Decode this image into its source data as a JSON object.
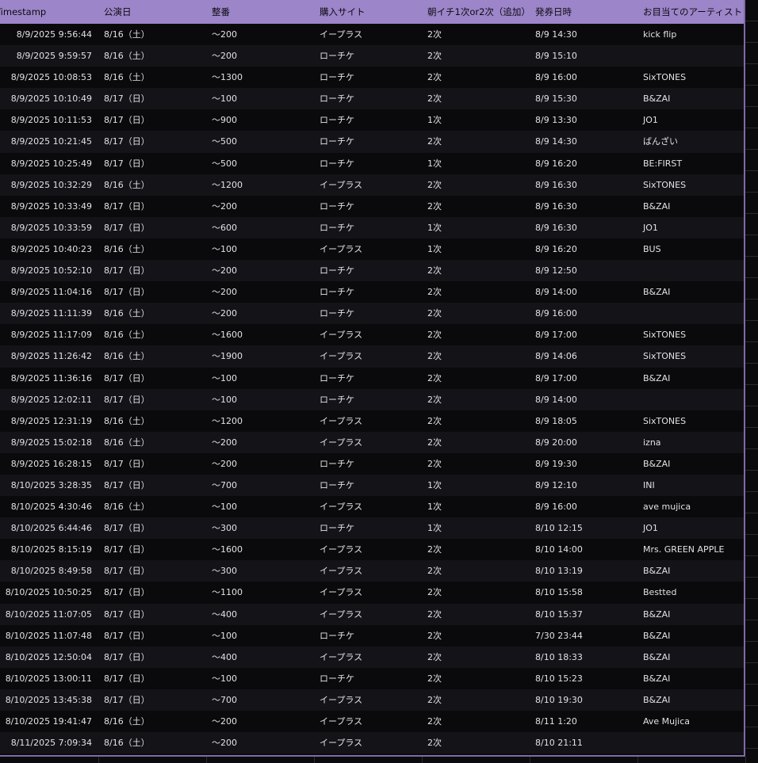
{
  "columns": {
    "timestamp": "Timestamp",
    "performance_date": "公演日",
    "ticket_number": "整番",
    "purchase_site": "購入サイト",
    "round": "朝イチ1次or2次（追加）",
    "release_datetime": "発券日時",
    "target_artist": "お目当てのアーティスト"
  },
  "rows": [
    [
      "8/9/2025 9:56:44",
      "8/16（土）",
      "〜200",
      "イープラス",
      "2次",
      "8/9 14:30",
      "kick flip"
    ],
    [
      "8/9/2025 9:59:57",
      "8/16（土）",
      "〜200",
      "ローチケ",
      "2次",
      "8/9 15:10",
      ""
    ],
    [
      "8/9/2025 10:08:53",
      "8/16（土）",
      "〜1300",
      "ローチケ",
      "2次",
      "8/9 16:00",
      "SixTONES"
    ],
    [
      "8/9/2025 10:10:49",
      "8/17（日）",
      "〜100",
      "ローチケ",
      "2次",
      "8/9 15:30",
      "B&ZAI"
    ],
    [
      "8/9/2025 10:11:53",
      "8/17（日）",
      "〜900",
      "ローチケ",
      "1次",
      "8/9 13:30",
      "JO1"
    ],
    [
      "8/9/2025 10:21:45",
      "8/17（日）",
      "〜500",
      "ローチケ",
      "2次",
      "8/9 14:30",
      "ばんざい"
    ],
    [
      "8/9/2025 10:25:49",
      "8/17（日）",
      "〜500",
      "ローチケ",
      "1次",
      "8/9 16:20",
      "BE:FIRST"
    ],
    [
      "8/9/2025 10:32:29",
      "8/16（土）",
      "〜1200",
      "イープラス",
      "2次",
      "8/9 16:30",
      "SixTONES"
    ],
    [
      "8/9/2025 10:33:49",
      "8/17（日）",
      "〜200",
      "ローチケ",
      "2次",
      "8/9 16:30",
      "B&ZAI"
    ],
    [
      "8/9/2025 10:33:59",
      "8/17（日）",
      "〜600",
      "ローチケ",
      "1次",
      "8/9 16:30",
      "JO1"
    ],
    [
      "8/9/2025 10:40:23",
      "8/16（土）",
      "〜100",
      "イープラス",
      "1次",
      "8/9 16:20",
      "BUS"
    ],
    [
      "8/9/2025 10:52:10",
      "8/17（日）",
      "〜200",
      "ローチケ",
      "2次",
      "8/9 12:50",
      ""
    ],
    [
      "8/9/2025 11:04:16",
      "8/17（日）",
      "〜200",
      "ローチケ",
      "2次",
      "8/9 14:00",
      "B&ZAI"
    ],
    [
      "8/9/2025 11:11:39",
      "8/16（土）",
      "〜200",
      "ローチケ",
      "2次",
      "8/9 16:00",
      ""
    ],
    [
      "8/9/2025 11:17:09",
      "8/16（土）",
      "〜1600",
      "イープラス",
      "2次",
      "8/9 17:00",
      "SixTONES"
    ],
    [
      "8/9/2025 11:26:42",
      "8/16（土）",
      "〜1900",
      "イープラス",
      "2次",
      "8/9 14:06",
      "SixTONES"
    ],
    [
      "8/9/2025 11:36:16",
      "8/17（日）",
      "〜100",
      "ローチケ",
      "2次",
      "8/9 17:00",
      "B&ZAI"
    ],
    [
      "8/9/2025 12:02:11",
      "8/17（日）",
      "〜100",
      "ローチケ",
      "2次",
      "8/9 14:00",
      ""
    ],
    [
      "8/9/2025 12:31:19",
      "8/16（土）",
      "〜1200",
      "イープラス",
      "2次",
      "8/9 18:05",
      "SixTONES"
    ],
    [
      "8/9/2025 15:02:18",
      "8/16（土）",
      "〜200",
      "イープラス",
      "2次",
      "8/9 20:00",
      "izna"
    ],
    [
      "8/9/2025 16:28:15",
      "8/17（日）",
      "〜200",
      "ローチケ",
      "2次",
      "8/9 19:30",
      "B&ZAI"
    ],
    [
      "8/10/2025 3:28:35",
      "8/17（日）",
      "〜700",
      "ローチケ",
      "1次",
      "8/9 12:10",
      "INI"
    ],
    [
      "8/10/2025 4:30:46",
      "8/16（土）",
      "〜100",
      "イープラス",
      "1次",
      "8/9 16:00",
      "ave mujica"
    ],
    [
      "8/10/2025 6:44:46",
      "8/17（日）",
      "〜300",
      "ローチケ",
      "1次",
      "8/10 12:15",
      "JO1"
    ],
    [
      "8/10/2025 8:15:19",
      "8/17（日）",
      "〜1600",
      "イープラス",
      "2次",
      "8/10 14:00",
      "Mrs. GREEN APPLE"
    ],
    [
      "8/10/2025 8:49:58",
      "8/17（日）",
      "〜300",
      "イープラス",
      "2次",
      "8/10 13:19",
      "B&ZAI"
    ],
    [
      "8/10/2025 10:50:25",
      "8/17（日）",
      "〜1100",
      "イープラス",
      "2次",
      "8/10 15:58",
      "Bestted"
    ],
    [
      "8/10/2025 11:07:05",
      "8/17（日）",
      "〜400",
      "イープラス",
      "2次",
      "8/10 15:37",
      "B&ZAI"
    ],
    [
      "8/10/2025 11:07:48",
      "8/17（日）",
      "〜100",
      "ローチケ",
      "2次",
      "7/30 23:44",
      "B&ZAI"
    ],
    [
      "8/10/2025 12:50:04",
      "8/17（日）",
      "〜400",
      "イープラス",
      "2次",
      "8/10 18:33",
      "B&ZAI"
    ],
    [
      "8/10/2025 13:00:11",
      "8/17（日）",
      "〜100",
      "ローチケ",
      "2次",
      "8/10 15:23",
      "B&ZAI"
    ],
    [
      "8/10/2025 13:45:38",
      "8/17（日）",
      "〜700",
      "イープラス",
      "2次",
      "8/10 19:30",
      "B&ZAI"
    ],
    [
      "8/10/2025 19:41:47",
      "8/16（土）",
      "〜200",
      "イープラス",
      "2次",
      "8/11 1:20",
      "Ave Mujica"
    ],
    [
      "8/11/2025 7:09:34",
      "8/16（土）",
      "〜200",
      "イープラス",
      "2次",
      "8/10 21:11",
      ""
    ]
  ],
  "colors": {
    "header_bg": "#9d85c9",
    "frame": "#7f6aa8",
    "row_dark": "#0a0a0c",
    "row_light": "#141418",
    "text": "#e2e2e6"
  }
}
